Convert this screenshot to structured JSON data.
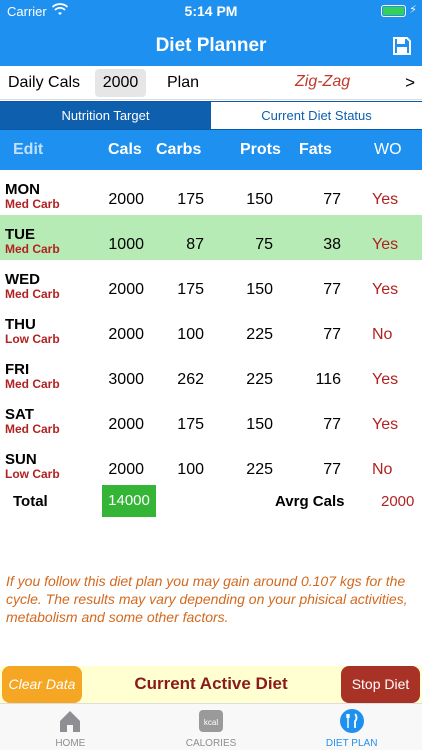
{
  "status": {
    "carrier": "Carrier",
    "time": "5:14 PM"
  },
  "nav": {
    "title": "Diet Planner",
    "save_icon": "floppy-disk-icon"
  },
  "settings": {
    "daily_cals_label": "Daily Cals",
    "daily_cals_value": "2000",
    "plan_label": "Plan",
    "plan_value": "Zig-Zag",
    "chevron": ">"
  },
  "tabs": {
    "nutrition": "Nutrition Target",
    "status": "Current Diet Status"
  },
  "columns": {
    "edit": "Edit",
    "cals": "Cals",
    "carbs": "Carbs",
    "prots": "Prots",
    "fats": "Fats",
    "wo": "WO"
  },
  "rows": [
    {
      "day": "MON",
      "type": "Med Carb",
      "cals": "2000",
      "carbs": "175",
      "prots": "150",
      "fats": "77",
      "wo": "Yes"
    },
    {
      "day": "TUE",
      "type": "Med Carb",
      "cals": "1000",
      "carbs": "87",
      "prots": "75",
      "fats": "38",
      "wo": "Yes"
    },
    {
      "day": "WED",
      "type": "Med Carb",
      "cals": "2000",
      "carbs": "175",
      "prots": "150",
      "fats": "77",
      "wo": "Yes"
    },
    {
      "day": "THU",
      "type": "Low Carb",
      "cals": "2000",
      "carbs": "100",
      "prots": "225",
      "fats": "77",
      "wo": "No"
    },
    {
      "day": "FRI",
      "type": "Med Carb",
      "cals": "3000",
      "carbs": "262",
      "prots": "225",
      "fats": "116",
      "wo": "Yes"
    },
    {
      "day": "SAT",
      "type": "Med Carb",
      "cals": "2000",
      "carbs": "175",
      "prots": "150",
      "fats": "77",
      "wo": "Yes"
    },
    {
      "day": "SUN",
      "type": "Low Carb",
      "cals": "2000",
      "carbs": "100",
      "prots": "225",
      "fats": "77",
      "wo": "No"
    }
  ],
  "total": {
    "label": "Total",
    "value": "14000",
    "avg_label": "Avrg Cals",
    "avg_value": "2000"
  },
  "note": "If you follow this diet plan you may gain around 0.107 kgs for the cycle. The results may vary depending on your phisical activities, metabolism and some other factors.",
  "actions": {
    "clear": "Clear Data",
    "title": "Current Active Diet",
    "stop": "Stop Diet"
  },
  "tabbar": [
    {
      "label": "HOME",
      "icon": "home-icon"
    },
    {
      "label": "CALORIES",
      "icon": "kcal-icon",
      "icon_text": "kcal"
    },
    {
      "label": "DIET PLAN",
      "icon": "fork-knife-icon"
    }
  ],
  "colors": {
    "header_blue": "#1E90F0",
    "segment_blue": "#0E5FAE",
    "highlight_green": "#B7EBB6",
    "total_green": "#35B535",
    "accent_red": "#B22222",
    "clear_orange": "#F5A623",
    "stop_red": "#A93226"
  }
}
